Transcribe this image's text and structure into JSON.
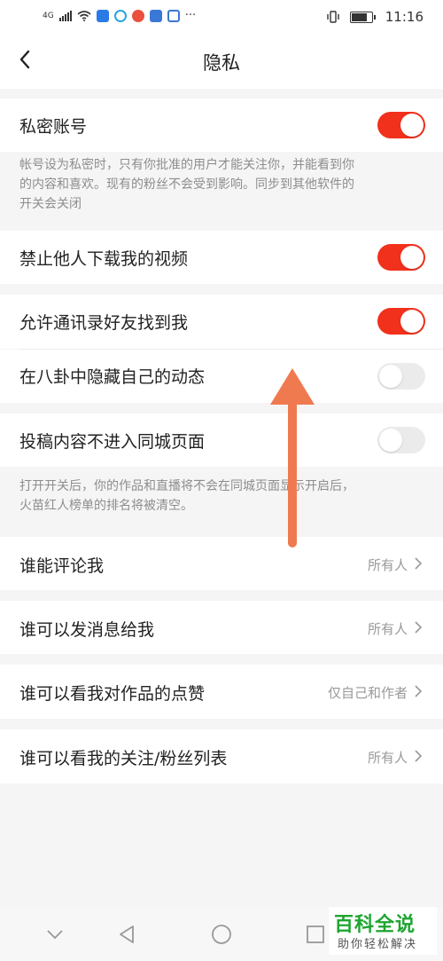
{
  "status_bar": {
    "signal_label": "4G",
    "time": "11:16",
    "more": "···"
  },
  "nav": {
    "title": "隐私",
    "back_icon": "chevron-left-icon"
  },
  "settings": {
    "private_account": {
      "label": "私密账号",
      "enabled": true,
      "desc_line1": "帐号设为私密时，只有你批准的用户才能关注你，并能看到你",
      "desc_line2": "的内容和喜欢。现有的粉丝不会受到影响。同步到其他软件的",
      "desc_line3": "开关会关闭"
    },
    "block_download": {
      "label": "禁止他人下载我的视频",
      "enabled": true
    },
    "contacts_find": {
      "label": "允许通讯录好友找到我",
      "enabled": true
    },
    "hide_gossip": {
      "label": "在八卦中隐藏自己的动态",
      "enabled": false
    },
    "no_same_city": {
      "label": "投稿内容不进入同城页面",
      "enabled": false,
      "desc_line1": "打开开关后，你的作品和直播将不会在同城页面显示开启后，",
      "desc_line2": "火苗红人榜单的排名将被清空。"
    },
    "comment": {
      "label": "谁能评论我",
      "value": "所有人"
    },
    "message": {
      "label": "谁可以发消息给我",
      "value": "所有人"
    },
    "likes": {
      "label": "谁可以看我对作品的点赞",
      "value": "仅自己和作者"
    },
    "follow_list": {
      "label": "谁可以看我的关注/粉丝列表",
      "value": "所有人"
    }
  },
  "colors": {
    "toggle_on": "#f1311c",
    "toggle_off": "#ebebeb",
    "arrow": "#f07a50",
    "watermark": "#1ea531"
  },
  "watermark": {
    "title": "百科全说",
    "subtitle": "助你轻松解决"
  }
}
